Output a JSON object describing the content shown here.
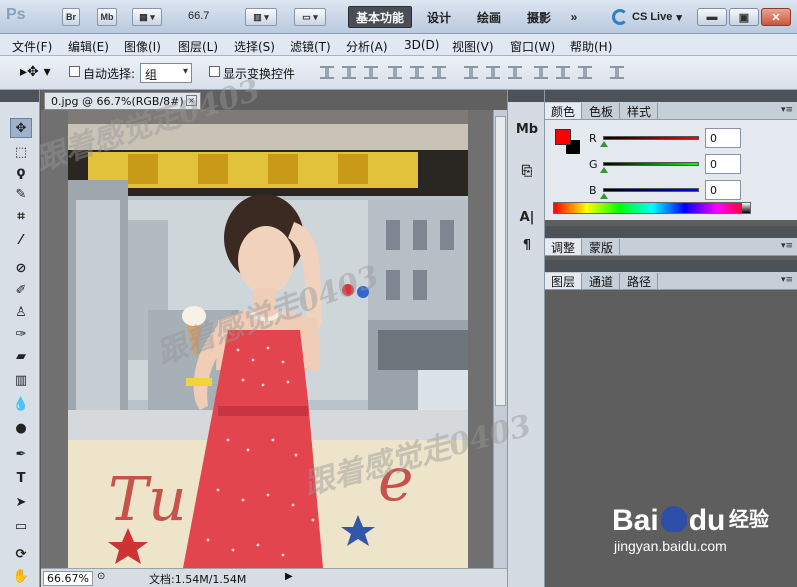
{
  "appbar": {
    "logo": "Ps",
    "bridge_btn": "Br",
    "minibridge_btn": "Mb",
    "zoom": "66.7",
    "workspaces": [
      {
        "label": "基本功能",
        "active": true
      },
      {
        "label": "设计",
        "active": false
      },
      {
        "label": "绘画",
        "active": false
      },
      {
        "label": "摄影",
        "active": false
      }
    ],
    "more": "»",
    "cslive": "CS Live",
    "win_minimize": "▬",
    "win_restore": "▣",
    "win_close": "✕"
  },
  "menu": [
    "文件(F)",
    "编辑(E)",
    "图像(I)",
    "图层(L)",
    "选择(S)",
    "滤镜(T)",
    "分析(A)",
    "3D(D)",
    "视图(V)",
    "窗口(W)",
    "帮助(H)"
  ],
  "options": {
    "auto_select_label": "自动选择:",
    "auto_select_value": "组",
    "show_transform_label": "显示变换控件"
  },
  "document": {
    "tab_label": "0.jpg @ 66.7%(RGB/8#)",
    "close": "×",
    "zoom": "66.67%",
    "doc_info": "文档:1.54M/1.54M"
  },
  "panels": {
    "color_tabs": [
      "颜色",
      "色板",
      "样式"
    ],
    "channels": [
      {
        "name": "R",
        "value": "0",
        "color": "#c00000"
      },
      {
        "name": "G",
        "value": "0",
        "color": "#00a000"
      },
      {
        "name": "B",
        "value": "0",
        "color": "#0000b0"
      }
    ],
    "fg_color": "#ff0000",
    "bg_color": "#000000",
    "adjust_tabs": [
      "调整",
      "蒙版"
    ],
    "layer_tabs": [
      "图层",
      "通道",
      "路径"
    ]
  },
  "watermark": {
    "text_a": "跟着感觉走0403",
    "text_b": "跟着感觉走0403",
    "text_c": "跟着感觉走0403"
  },
  "baidu": {
    "brand": "Bai",
    "brand2": "du",
    "jingyan": "经验",
    "url": "jingyan.baidu.com"
  }
}
